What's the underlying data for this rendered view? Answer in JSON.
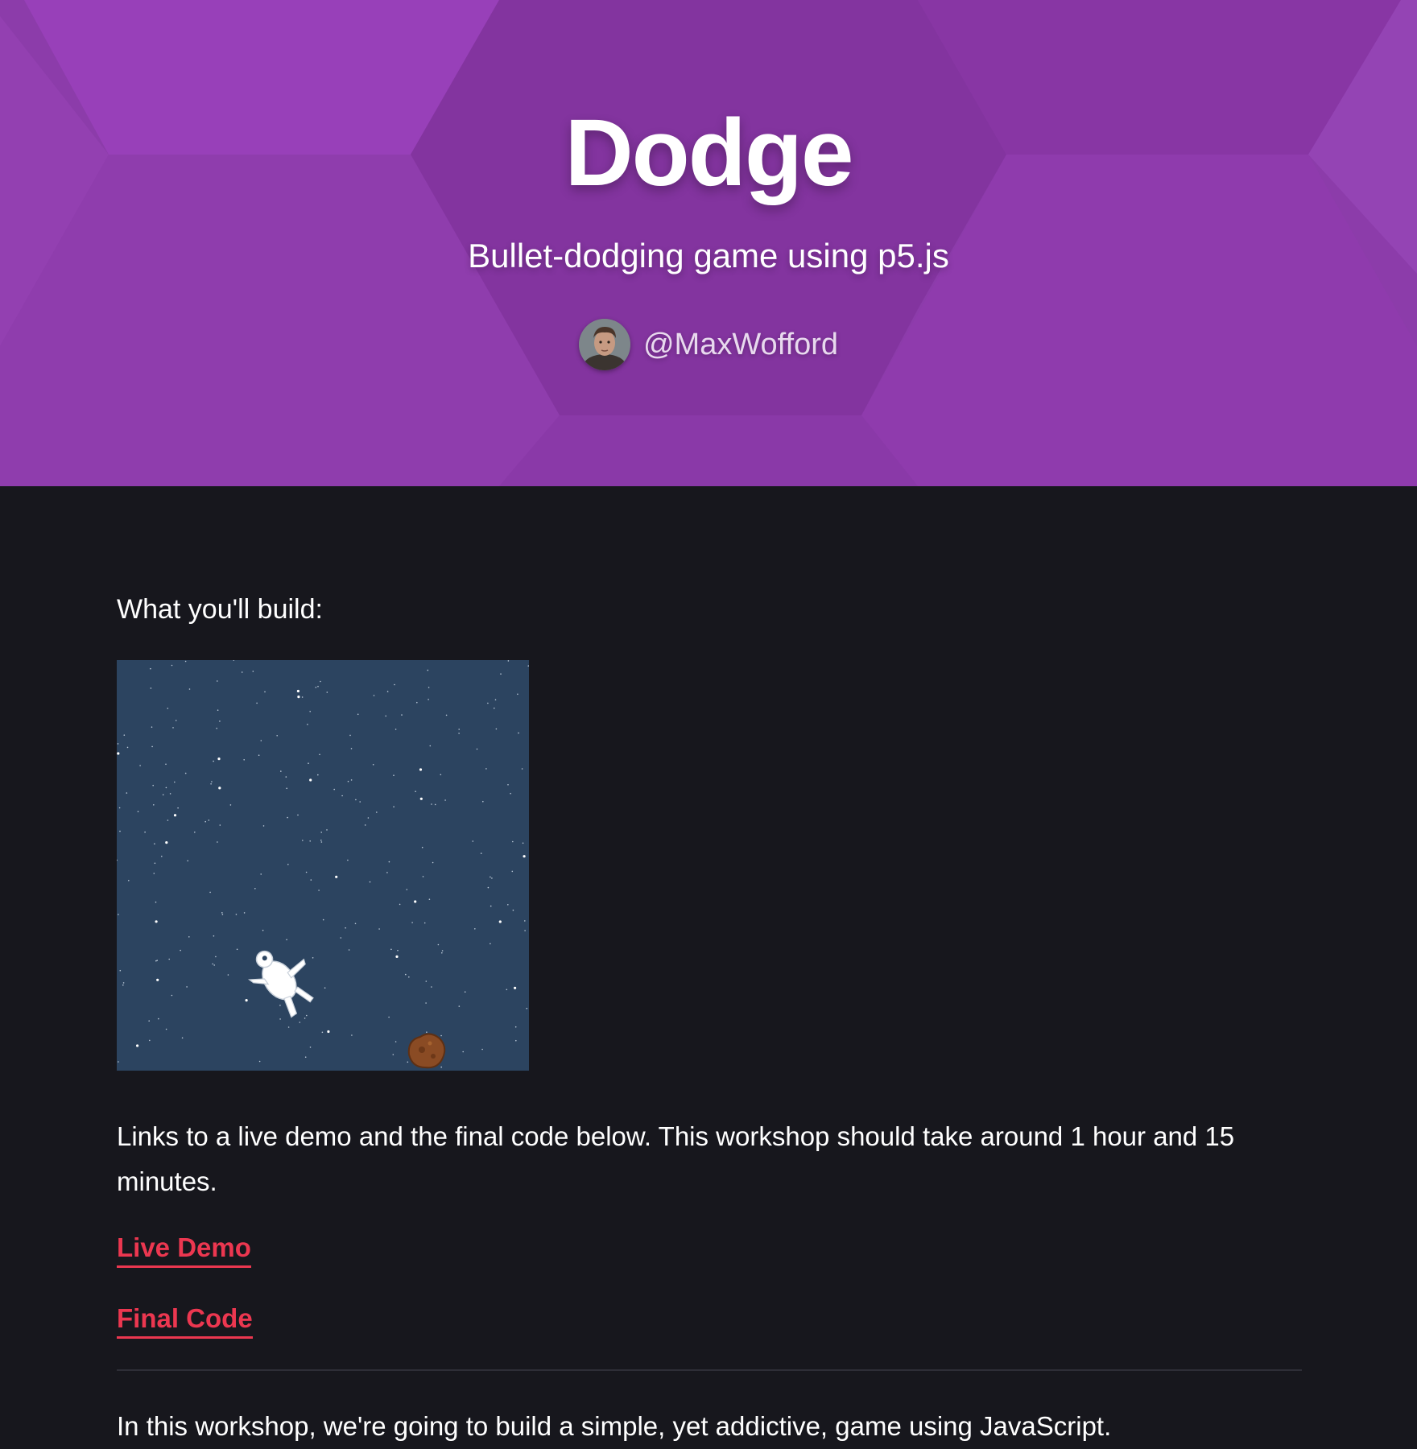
{
  "hero": {
    "title": "Dodge",
    "subtitle": "Bullet-dodging game using p5.js",
    "author": "@MaxWofford",
    "background_color": "#8a3aaa"
  },
  "main": {
    "intro": "What you'll build:",
    "description": "Links to a live demo and the final code below. This workshop should take around 1 hour and 15 minutes.",
    "links": {
      "demo": "Live Demo",
      "code": "Final Code"
    },
    "body_start": "In this workshop, we're going to build a simple, yet addictive, game using JavaScript.",
    "link_color": "#ec3750",
    "background_color": "#17171d"
  }
}
